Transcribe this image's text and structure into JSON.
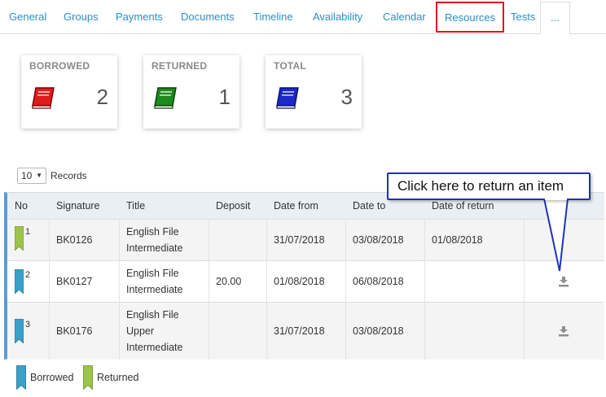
{
  "tabs": [
    {
      "label": "General"
    },
    {
      "label": "Groups"
    },
    {
      "label": "Payments"
    },
    {
      "label": "Documents"
    },
    {
      "label": "Timeline"
    },
    {
      "label": "Availability"
    },
    {
      "label": "Calendar"
    },
    {
      "label": "Resources"
    },
    {
      "label": "Tests"
    },
    {
      "label": "..."
    }
  ],
  "stats": {
    "borrowed": {
      "label": "BORROWED",
      "value": "2",
      "color": "#e01b1b"
    },
    "returned": {
      "label": "RETURNED",
      "value": "1",
      "color": "#1e8a1e"
    },
    "total": {
      "label": "TOTAL",
      "value": "3",
      "color": "#1c28c8"
    }
  },
  "records": {
    "selected": "10",
    "label": "Records"
  },
  "table": {
    "headers": {
      "no": "No",
      "signature": "Signature",
      "title": "Title",
      "deposit": "Deposit",
      "date_from": "Date from",
      "date_to": "Date to",
      "date_return": "Date of return"
    },
    "rows": [
      {
        "no": "1",
        "status": "returned",
        "signature": "BK0126",
        "title1": "English File",
        "title2": "Intermediate",
        "title3": "",
        "deposit": "",
        "date_from": "31/07/2018",
        "date_to": "03/08/2018",
        "date_return": "01/08/2018"
      },
      {
        "no": "2",
        "status": "borrowed",
        "signature": "BK0127",
        "title1": "English File",
        "title2": "Intermediate",
        "title3": "",
        "deposit": "20.00",
        "date_from": "01/08/2018",
        "date_to": "06/08/2018",
        "date_return": ""
      },
      {
        "no": "3",
        "status": "borrowed",
        "signature": "BK0176",
        "title1": "English File",
        "title2": "Upper",
        "title3": "Intermediate",
        "deposit": "",
        "date_from": "31/07/2018",
        "date_to": "03/08/2018",
        "date_return": ""
      }
    ]
  },
  "callout": {
    "text": "Click here to return an item"
  },
  "legend": {
    "borrowed": "Borrowed",
    "returned": "Returned"
  },
  "colors": {
    "borrowed_ribbon": "#3aa0c8",
    "returned_ribbon": "#9cc34a",
    "accent": "#2a8fc9",
    "highlight": "#e0141e"
  }
}
